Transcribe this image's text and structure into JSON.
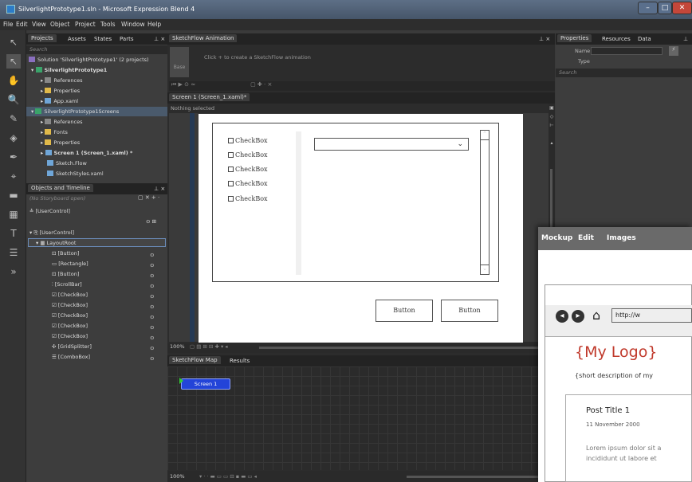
{
  "window": {
    "title": "SilverlightPrototype1.sln - Microsoft Expression Blend 4",
    "minimize": "–",
    "maximize": "□",
    "close": "✕"
  },
  "menu": [
    "File",
    "Edit",
    "View",
    "Object",
    "Project",
    "Tools",
    "Window",
    "Help"
  ],
  "projects_panel": {
    "tabs": [
      "Projects",
      "Assets",
      "States",
      "Parts"
    ],
    "search_placeholder": "Search",
    "tree": [
      "Solution 'SilverlightPrototype1' (2 projects)",
      "SilverlightPrototype1",
      "References",
      "Properties",
      "App.xaml",
      "SilverlightPrototype1Screens",
      "References",
      "Fonts",
      "Properties",
      "Screen 1 (Screen_1.xaml) *",
      "Sketch.Flow",
      "SketchStyles.xaml"
    ]
  },
  "objects_panel": {
    "title": "Objects and Timeline",
    "storyboard": "(No Storyboard open)",
    "usercontrol_top": "[UserControl]",
    "tree": [
      "[UserControl]",
      "LayoutRoot",
      "[Button]",
      "[Rectangle]",
      "[Button]",
      "[ScrollBar]",
      "[CheckBox]",
      "[CheckBox]",
      "[CheckBox]",
      "[CheckBox]",
      "[CheckBox]",
      "[GridSplitter]",
      "[ComboBox]"
    ]
  },
  "animation": {
    "tab": "SketchFlow Animation",
    "base": "Base",
    "hint": "Click  +  to create a SketchFlow animation"
  },
  "document": {
    "tab": "Screen 1 (Screen_1.xaml)*",
    "status": "Nothing selected",
    "zoom": "100%",
    "checkboxes": [
      "CheckBox",
      "CheckBox",
      "CheckBox",
      "CheckBox",
      "CheckBox"
    ],
    "buttons": [
      "Button",
      "Button"
    ]
  },
  "map": {
    "tabs": [
      "SketchFlow Map",
      "Results"
    ],
    "node": "Screen 1",
    "zoom": "100%"
  },
  "properties_panel": {
    "tabs": [
      "Properties",
      "Resources",
      "Data"
    ],
    "name_label": "Name",
    "type_label": "Type",
    "search_placeholder": "Search"
  },
  "mockup": {
    "menu": [
      "Mockup",
      "Edit",
      "Images"
    ],
    "url": "http://w",
    "logo": "{My Logo}",
    "description": "{short description of my",
    "post_title": "Post Title 1",
    "post_date": "11 November 2000",
    "body": "Lorem ipsum dolor sit a",
    "body2": "incididunt ut labore et"
  }
}
